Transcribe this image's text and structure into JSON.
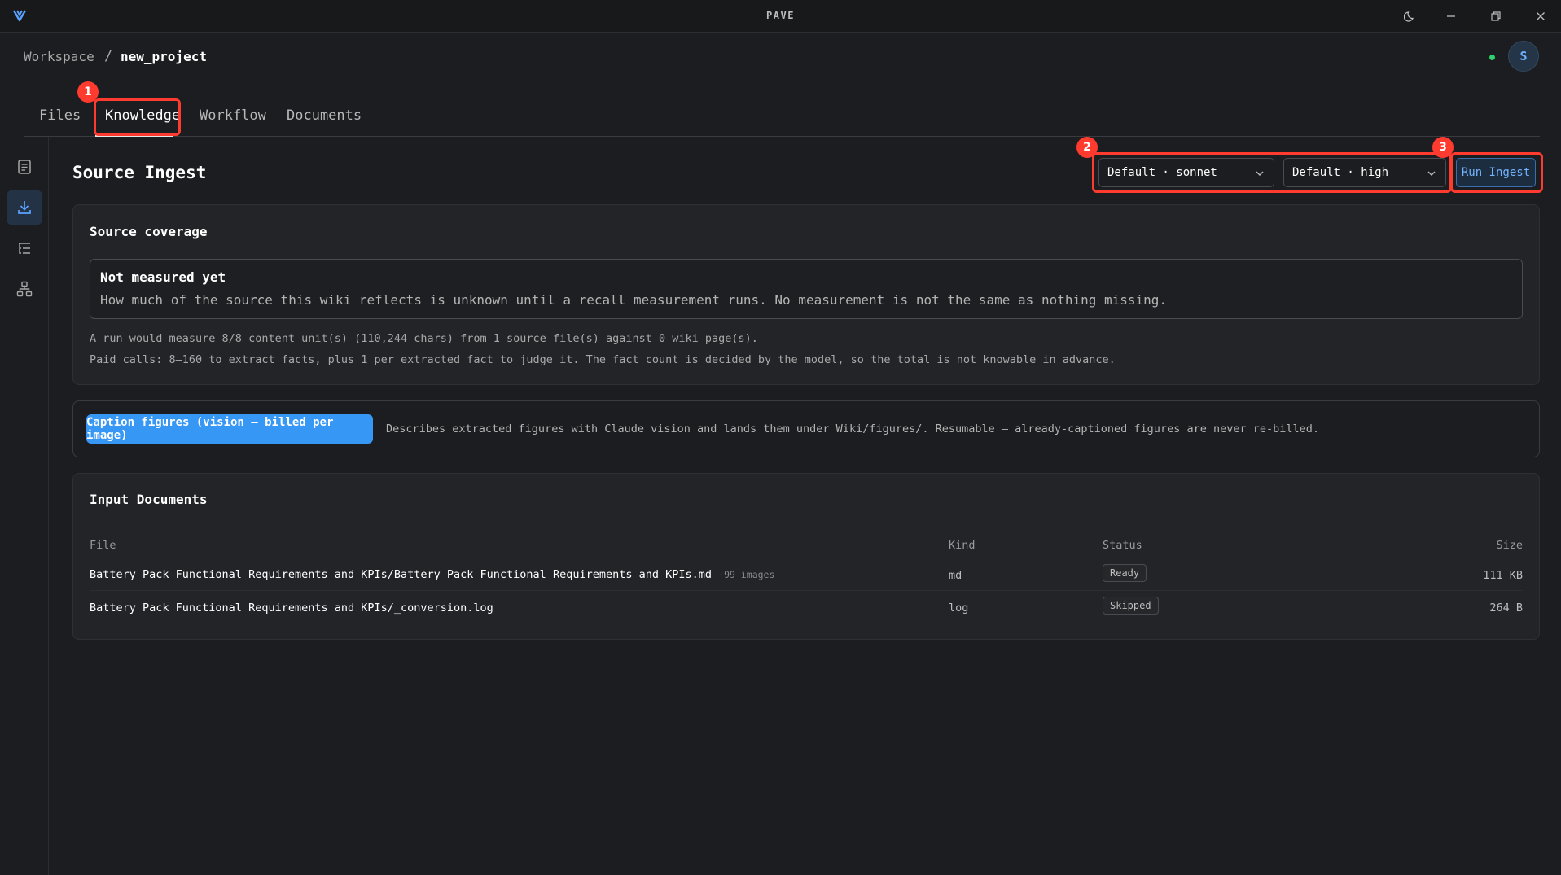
{
  "app": {
    "title": "PAVE"
  },
  "breadcrumb": {
    "workspace": "Workspace",
    "separator": "/",
    "project": "new_project"
  },
  "user": {
    "initial": "S",
    "status_color": "#2fd16c"
  },
  "tabs": [
    {
      "label": "Files"
    },
    {
      "label": "Knowledge",
      "active": true
    },
    {
      "label": "Workflow"
    },
    {
      "label": "Documents"
    }
  ],
  "rail": [
    "document-icon",
    "download-icon",
    "list-tree-icon",
    "hierarchy-icon"
  ],
  "header": {
    "title": "Source Ingest",
    "model_select": "Default · sonnet",
    "effort_select": "Default · high",
    "run_label": "Run Ingest"
  },
  "annotations": [
    "1",
    "2",
    "3"
  ],
  "coverage": {
    "title": "Source coverage",
    "status_head": "Not measured yet",
    "status_body": "How much of the source this wiki reflects is unknown until a recall measurement runs. No measurement is not the same as nothing missing.",
    "note1": "A run would measure 8/8 content unit(s) (110,244 chars) from 1 source file(s) against 0 wiki page(s).",
    "note2": "Paid calls: 8–160 to extract facts, plus 1 per extracted fact to judge it. The fact count is decided by the model, so the total is not knowable in advance."
  },
  "caption": {
    "button": "Caption figures (vision — billed per image)",
    "description": "Describes extracted figures with Claude vision and lands them under Wiki/figures/. Resumable — already-captioned figures are never re-billed."
  },
  "inputs": {
    "title": "Input Documents",
    "columns": {
      "file": "File",
      "kind": "Kind",
      "status": "Status",
      "size": "Size"
    },
    "rows": [
      {
        "file": "Battery Pack Functional Requirements and KPIs/Battery Pack Functional Requirements and KPIs.md",
        "extra": "+99 images",
        "kind": "md",
        "status": "Ready",
        "size": "111 KB"
      },
      {
        "file": "Battery Pack Functional Requirements and KPIs/_conversion.log",
        "extra": "",
        "kind": "log",
        "status": "Skipped",
        "size": "264 B"
      }
    ]
  },
  "colors": {
    "accent": "#3797f5",
    "highlight": "#ff3b30",
    "background": "#1c1d20",
    "card": "#232428"
  }
}
